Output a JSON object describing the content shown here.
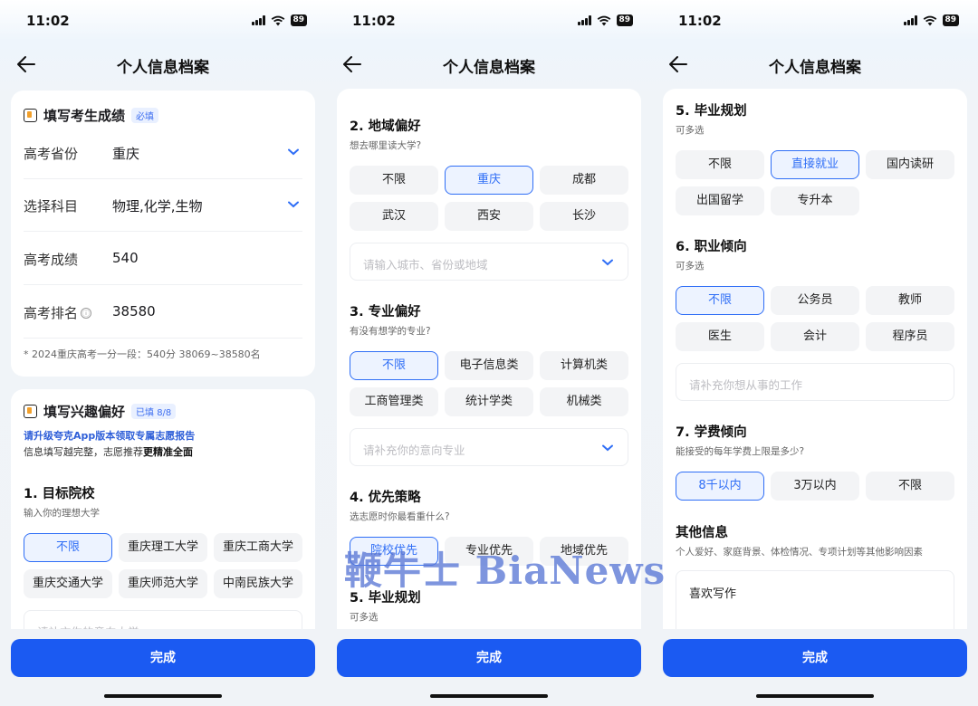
{
  "status": {
    "time": "11:02",
    "battery": "89"
  },
  "header": {
    "title": "个人信息档案"
  },
  "done_label": "完成",
  "watermark": "鞭牛士 BiaNews",
  "screen1": {
    "score_card": {
      "title": "填写考生成绩",
      "badge": "必填",
      "fields": [
        {
          "label": "高考省份",
          "value": "重庆"
        },
        {
          "label": "选择科目",
          "value": "物理,化学,生物"
        },
        {
          "label": "高考成绩",
          "value": "540"
        },
        {
          "label": "高考排名",
          "value": "38580"
        }
      ],
      "info_icon": "ⓘ",
      "note": "* 2024重庆高考一分一段：540分 38069~38580名"
    },
    "interest_card": {
      "title": "填写兴趣偏好",
      "badge": "已填 8/8",
      "promo": "请升级夸克App版本领取专属志愿报告",
      "tip_prefix": "信息填写越完整，志愿推荐",
      "tip_bold": "更精准全面",
      "q1": {
        "title": "1. 目标院校",
        "subtitle": "输入你的理想大学",
        "options": [
          "不限",
          "重庆理工大学",
          "重庆工商大学",
          "重庆交通大学",
          "重庆师范大学",
          "中南民族大学"
        ],
        "placeholder": "请补充你的意向大学"
      }
    }
  },
  "screen2": {
    "q2": {
      "title": "2. 地域偏好",
      "subtitle": "想去哪里读大学?",
      "options": [
        "不限",
        "重庆",
        "成都",
        "武汉",
        "西安",
        "长沙"
      ],
      "placeholder": "请输入城市、省份或地域"
    },
    "q3": {
      "title": "3. 专业偏好",
      "subtitle": "有没有想学的专业?",
      "options": [
        "不限",
        "电子信息类",
        "计算机类",
        "工商管理类",
        "统计学类",
        "机械类"
      ],
      "placeholder": "请补充你的意向专业"
    },
    "q4": {
      "title": "4. 优先策略",
      "subtitle": "选志愿时你最看重什么?",
      "options": [
        "院校优先",
        "专业优先",
        "地域优先"
      ]
    },
    "q5": {
      "title": "5. 毕业规划",
      "subtitle": "可多选"
    }
  },
  "screen3": {
    "q5": {
      "title": "5. 毕业规划",
      "subtitle": "可多选",
      "options": [
        "不限",
        "直接就业",
        "国内读研",
        "出国留学",
        "专升本"
      ]
    },
    "q6": {
      "title": "6. 职业倾向",
      "subtitle": "可多选",
      "options": [
        "不限",
        "公务员",
        "教师",
        "医生",
        "会计",
        "程序员"
      ],
      "placeholder": "请补充你想从事的工作"
    },
    "q7": {
      "title": "7. 学费倾向",
      "subtitle": "能接受的每年学费上限是多少?",
      "options": [
        "8千以内",
        "3万以内",
        "不限"
      ]
    },
    "other": {
      "title": "其他信息",
      "subtitle": "个人爱好、家庭背景、体检情况、专项计划等其他影响因素",
      "value": "喜欢写作"
    }
  }
}
